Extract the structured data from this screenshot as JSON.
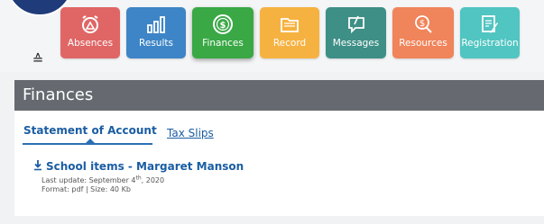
{
  "nav": {
    "tiles": [
      {
        "label": "Absences",
        "color": "#e06666",
        "icon": "alarm-clock-icon"
      },
      {
        "label": "Results",
        "color": "#3d85c6",
        "icon": "bar-chart-icon"
      },
      {
        "label": "Finances",
        "color": "#39a845",
        "icon": "dollar-coin-icon"
      },
      {
        "label": "Record",
        "color": "#f6b240",
        "icon": "folder-icon"
      },
      {
        "label": "Messages",
        "color": "#3e8f86",
        "icon": "message-icon"
      },
      {
        "label": "Resources",
        "color": "#f0845a",
        "icon": "resources-icon"
      },
      {
        "label": "Registration",
        "color": "#50c5c1",
        "icon": "registration-form-icon"
      }
    ]
  },
  "section": {
    "title": "Finances"
  },
  "tabs": {
    "statement": "Statement of Account",
    "tax": "Tax Slips"
  },
  "document": {
    "title": "School items - Margaret Manson",
    "last_update_prefix": "Last update: September 4",
    "last_update_sup": "th",
    "last_update_suffix": ", 2020",
    "format_size": "Format: pdf | Size: 40 Kb"
  }
}
